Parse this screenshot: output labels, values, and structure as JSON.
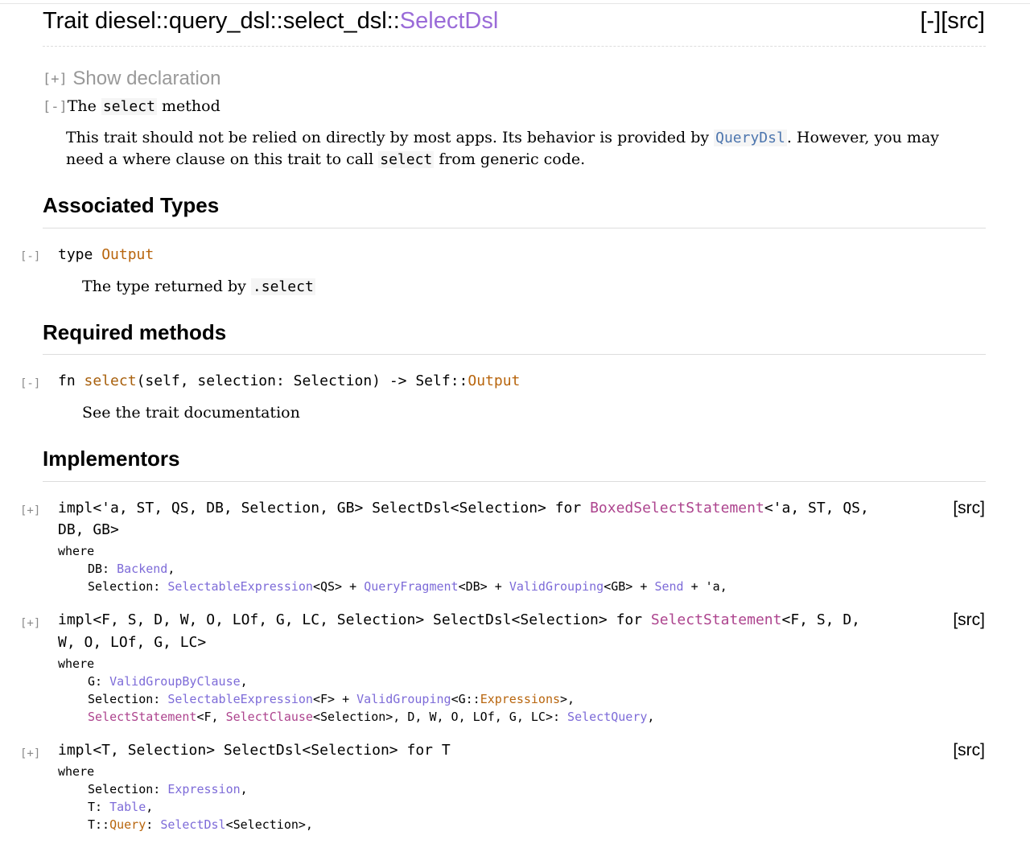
{
  "header": {
    "title_prefix": "Trait diesel::query_dsl::select_dsl::",
    "title_name": "SelectDsl",
    "collapse": "[-]",
    "src": "[src]"
  },
  "declaration": {
    "toggle": "[+]",
    "label": "Show declaration"
  },
  "method_doc": {
    "toggle": "[-]",
    "the": "The",
    "select_code": "select",
    "method": "method",
    "p1": "This trait should not be relied on directly by most apps. Its behavior is provided by ",
    "querydsl": "QueryDsl",
    "p2": ". However, you may need a where clause on this trait to call ",
    "select_code2": "select",
    "p3": " from generic code."
  },
  "associated_types": {
    "heading": "Associated Types",
    "toggle": "[-]",
    "kw": "type",
    "name": "Output",
    "doc_text": "The type returned by",
    "doc_code": ".select"
  },
  "required_methods": {
    "heading": "Required methods",
    "toggle": "[-]",
    "kw": "fn",
    "name": "select",
    "sig_mid": "(self, selection: Selection) -> Self::",
    "ret": "Output",
    "doc": "See the trait documentation"
  },
  "implementors": {
    "heading": "Implementors",
    "items": [
      {
        "toggle": "[+]",
        "line1_a": "impl<'a, ST, QS, DB, Selection, GB> SelectDsl<Selection> for ",
        "line1_struct": "BoxedSelectStatement",
        "line1_b": "<'a, ST, QS,",
        "line2": "DB, GB>",
        "where": "where",
        "src": "[src]",
        "w1_a": "DB: ",
        "w1_t": "Backend",
        "w1_b": ",",
        "w2_a": "Selection: ",
        "w2_t1": "SelectableExpression",
        "w2_b": "<QS> + ",
        "w2_t2": "QueryFragment",
        "w2_c": "<DB> + ",
        "w2_t3": "ValidGrouping",
        "w2_d": "<GB> + ",
        "w2_t4": "Send",
        "w2_e": " + 'a,"
      },
      {
        "toggle": "[+]",
        "line1_a": "impl<F, S, D, W, O, LOf, G, LC, Selection> SelectDsl<Selection> for ",
        "line1_struct": "SelectStatement",
        "line1_b": "<F, S, D,",
        "line2": "W, O, LOf, G, LC>",
        "where": "where",
        "src": "[src]",
        "w1_a": "G: ",
        "w1_t": "ValidGroupByClause",
        "w1_b": ",",
        "w2_a": "Selection: ",
        "w2_t1": "SelectableExpression",
        "w2_b": "<F> + ",
        "w2_t2": "ValidGrouping",
        "w2_c": "<G::",
        "w2_t3": "Expressions",
        "w2_d": ">,",
        "w3_s1": "SelectStatement",
        "w3_a": "<F, ",
        "w3_s2": "SelectClause",
        "w3_b": "<Selection>, D, W, O, LOf, G, LC>: ",
        "w3_t": "SelectQuery",
        "w3_c": ","
      },
      {
        "toggle": "[+]",
        "line1_a": "impl<T, Selection> SelectDsl<Selection> for T",
        "where": "where",
        "src": "[src]",
        "w1_a": "Selection: ",
        "w1_t": "Expression",
        "w1_b": ",",
        "w2_a": "T: ",
        "w2_t1": "Table",
        "w2_b": ",",
        "w3_a": "T::",
        "w3_assoc": "Query",
        "w3_b": ": ",
        "w3_t": "SelectDsl",
        "w3_c": "<Selection>,"
      }
    ]
  }
}
